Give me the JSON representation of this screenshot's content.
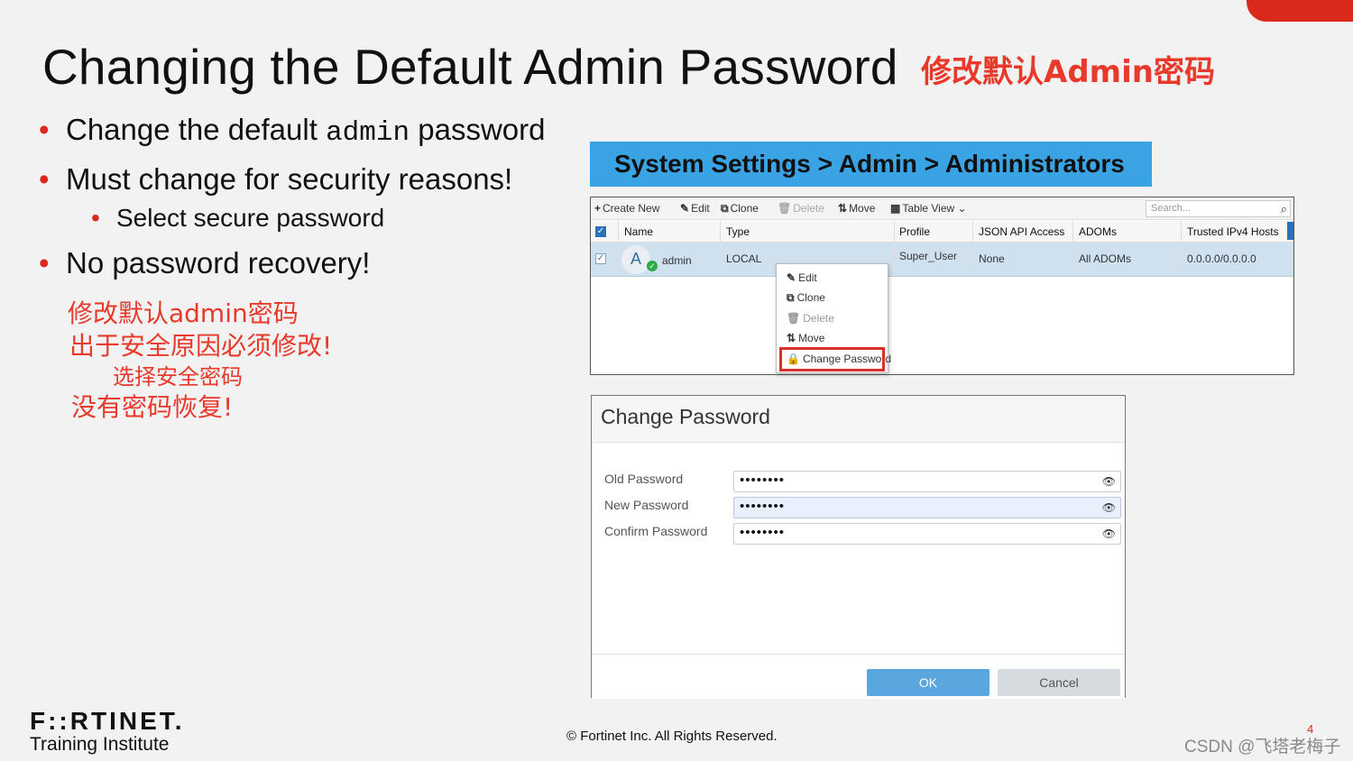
{
  "slide": {
    "title": "Changing the Default Admin Password",
    "title_cn": "修改默认Admin密码",
    "bullets": {
      "b1_pre": "Change the default ",
      "b1_code": "admin",
      "b1_post": " password",
      "b2": "Must change for security reasons!",
      "b3": "Select secure password",
      "b4": "No password recovery!"
    },
    "bullet_glyph": "•",
    "cn_notes": [
      "修改默认admin密码",
      "出于安全原因必须修改!",
      "选择安全密码",
      "没有密码恢复!"
    ]
  },
  "banner": {
    "path": "System Settings > Admin > Administrators"
  },
  "admin_table": {
    "toolbar": {
      "create_new": "Create New",
      "edit": "Edit",
      "clone": "Clone",
      "delete": "Delete",
      "move": "Move",
      "table_view": "Table View",
      "search_placeholder": "Search..."
    },
    "columns": [
      "Name",
      "Type",
      "Profile",
      "JSON API Access",
      "ADOMs",
      "Trusted IPv4 Hosts"
    ],
    "row": {
      "avatar_letter": "A",
      "name": "admin",
      "type": "LOCAL",
      "profile": "Super_User",
      "json_api": "None",
      "adoms": "All ADOMs",
      "trusted_hosts": "0.0.0.0/0.0.0.0"
    },
    "context_menu": [
      "Edit",
      "Clone",
      "Delete",
      "Move",
      "Change Password"
    ]
  },
  "dialog": {
    "title": "Change Password",
    "fields": [
      {
        "label": "Old Password",
        "value": "••••••••"
      },
      {
        "label": "New Password",
        "value": "••••••••"
      },
      {
        "label": "Confirm Password",
        "value": "••••••••"
      }
    ],
    "ok_label": "OK",
    "cancel_label": "Cancel"
  },
  "footer": {
    "logo": "F::RTINET.",
    "logo_sub": "Training Institute",
    "copyright": "© Fortinet Inc. All Rights Reserved.",
    "page": "4",
    "watermark": "CSDN @飞塔老梅子"
  },
  "colors": {
    "accent_red": "#da291c",
    "banner_blue": "#3aa3e3",
    "ok_blue": "#5aa7e0",
    "cn_red": "#e8392b"
  }
}
